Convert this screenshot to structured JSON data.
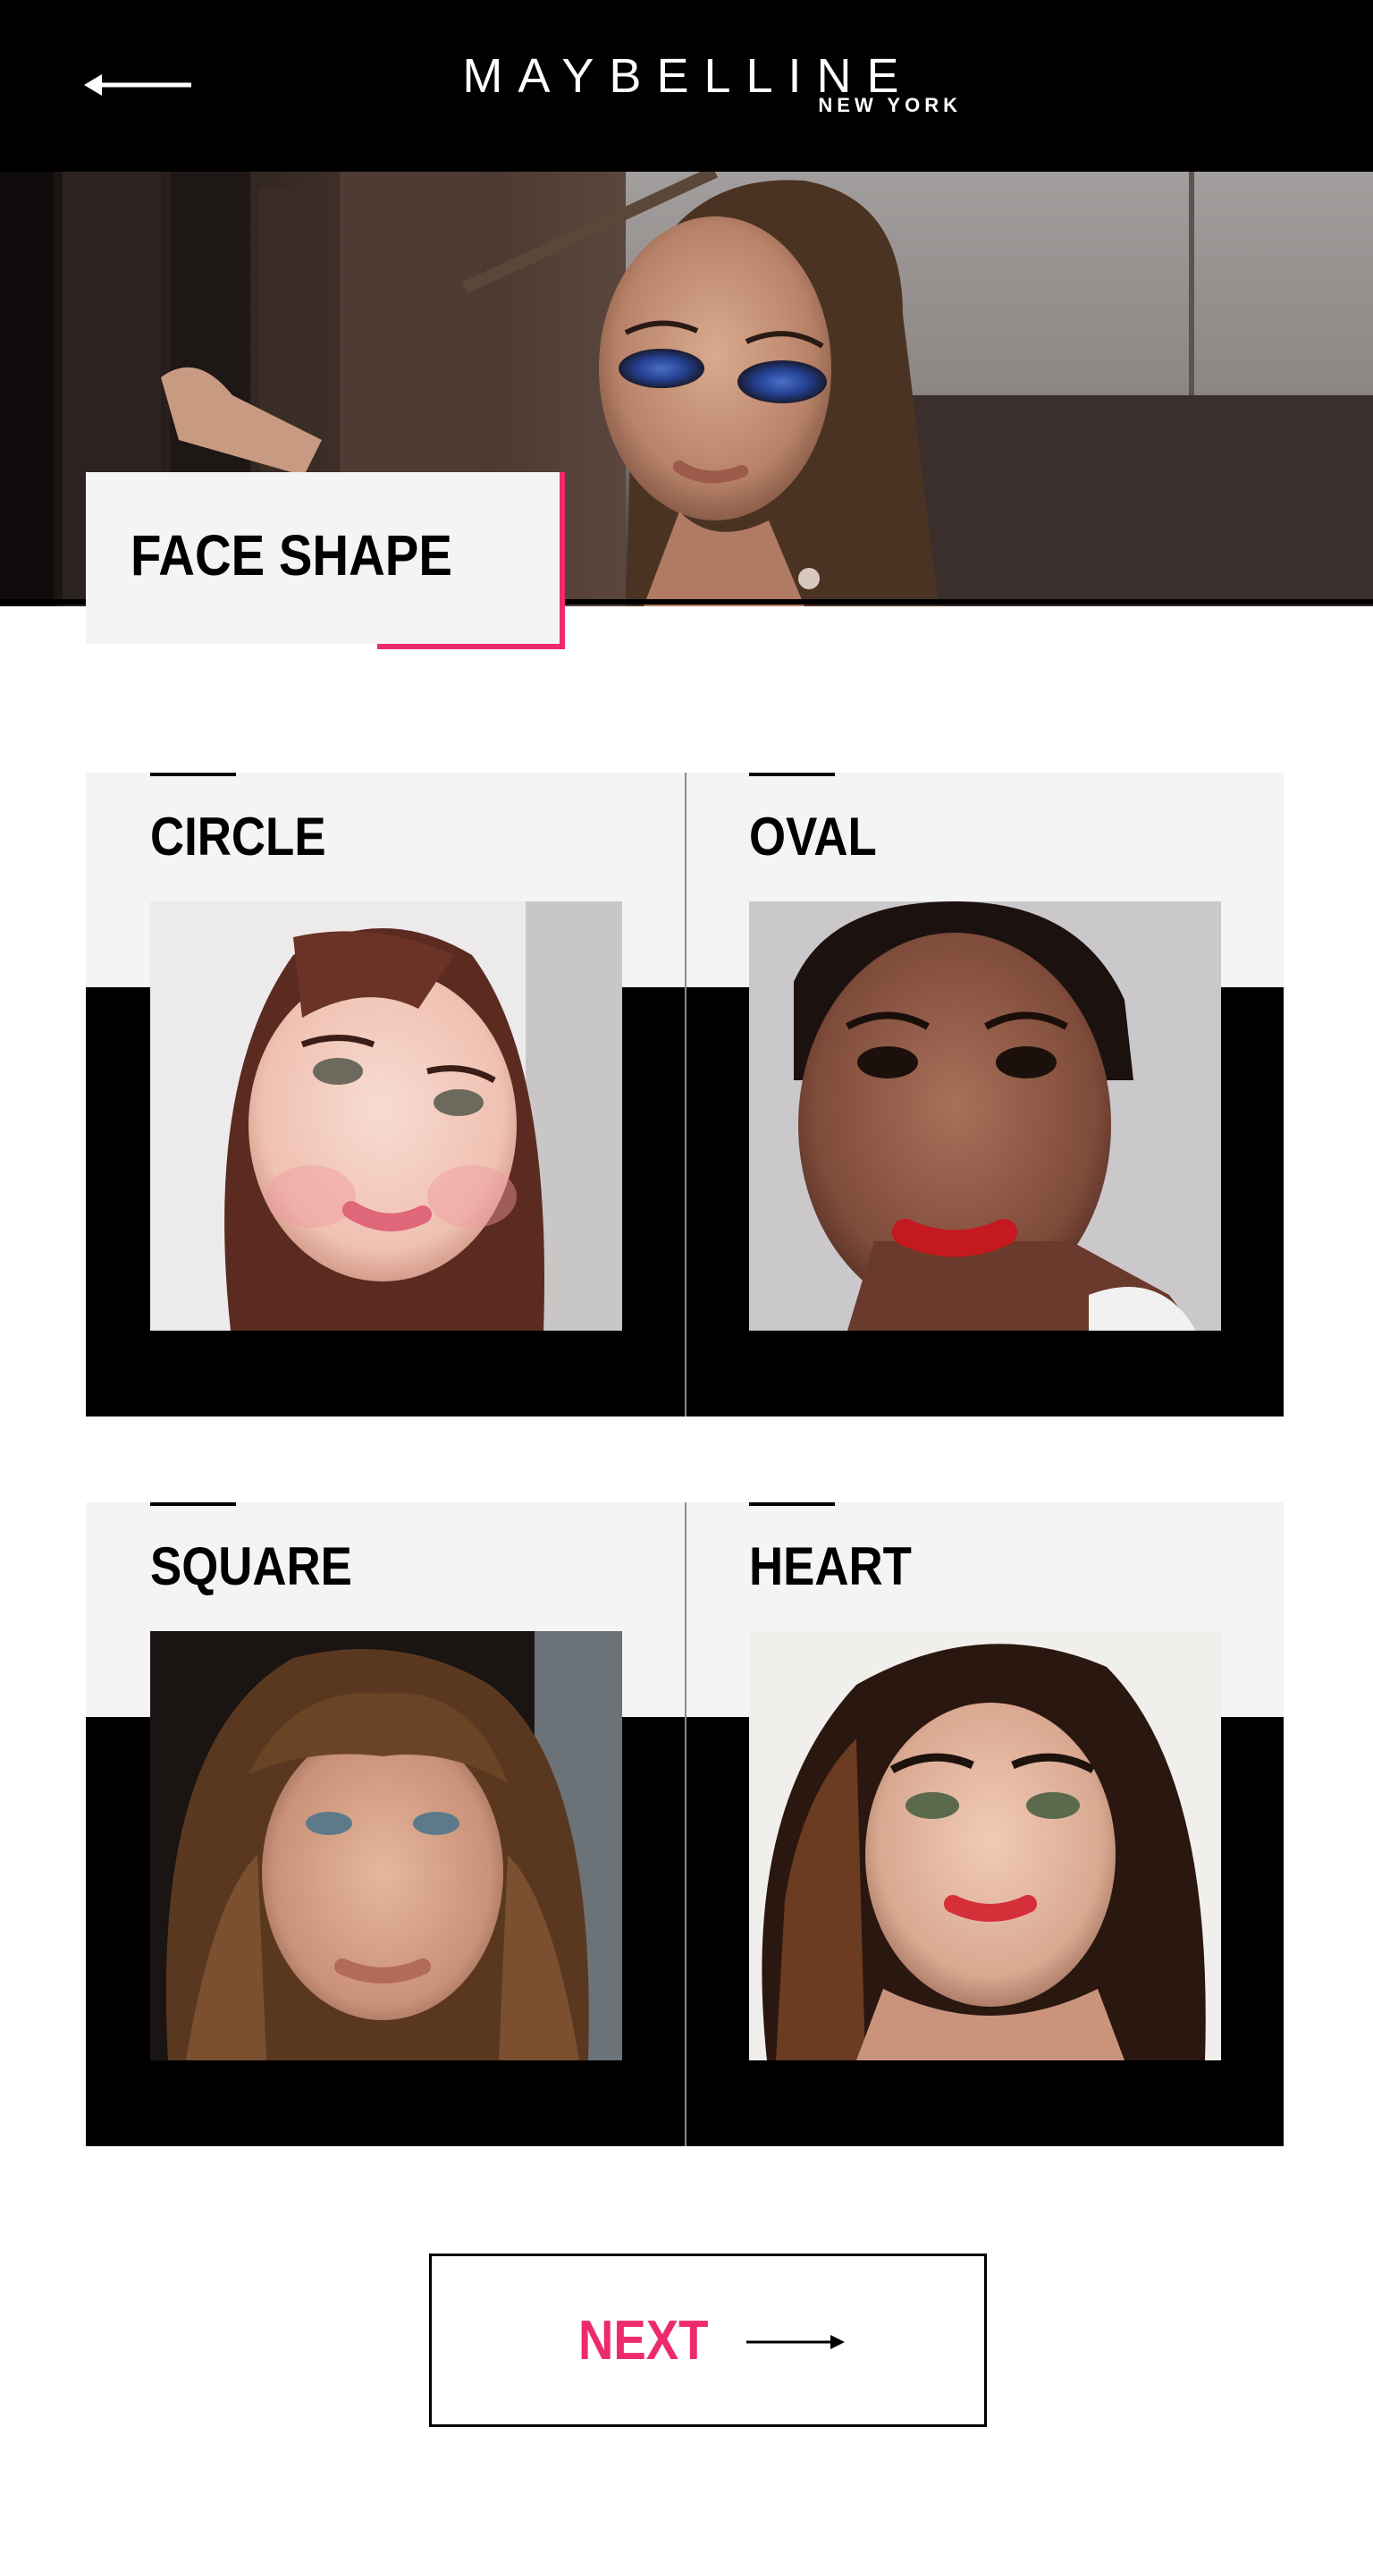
{
  "header": {
    "back_icon": "arrow-left-icon",
    "brand_name": "MAYBELLINE",
    "brand_sub": "NEW YORK"
  },
  "hero": {
    "image": "model with blue smoky eye makeup",
    "title": "FACE SHAPE",
    "accent_color": "#ed2a6e"
  },
  "face_shapes": [
    {
      "label": "CIRCLE",
      "image": "round face portrait, long auburn hair"
    },
    {
      "label": "OVAL",
      "image": "oval face portrait, red lipstick"
    },
    {
      "label": "SQUARE",
      "image": "square face portrait, brown fringe"
    },
    {
      "label": "HEART",
      "image": "heart face portrait, dark wavy hair"
    }
  ],
  "footer": {
    "next_label": "NEXT",
    "next_icon": "arrow-right-icon",
    "next_color": "#ed2a6e"
  }
}
